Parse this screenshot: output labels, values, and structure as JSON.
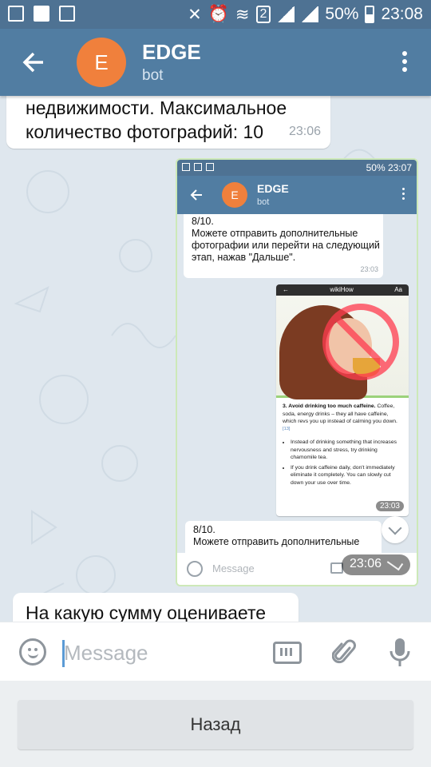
{
  "status_bar": {
    "battery": "50%",
    "time": "23:08",
    "sim_badge": "2"
  },
  "header": {
    "avatar_letter": "E",
    "title": "EDGE",
    "subtitle": "bot"
  },
  "messages": {
    "first": {
      "text": "недвижимости. Максимальное количество фотографий: 10",
      "time": "23:06"
    },
    "last": {
      "text": "На какую сумму оцениваете"
    }
  },
  "forwarded_screenshot": {
    "status": "50% 23:07",
    "avatar_letter": "E",
    "title": "EDGE",
    "subtitle": "bot",
    "message_1": {
      "text": "8/10.\nМожете отправить дополнительные фотографии или перейти на следующий этап, нажав \"Дальше\".",
      "time": "23:03"
    },
    "wikihow": {
      "site": "wikiHow",
      "step_title": "3. Avoid drinking too much caffeine.",
      "step_body": "Coffee, soda, energy drinks – they all have caffeine, which revs you up instead of calming you down.",
      "ref": "[13]",
      "bullet_1": "Instead of drinking something that increases nervousness and stress, try drinking chamomile tea.",
      "bullet_2": "If you drink caffeine daily, don't immediately eliminate it completely. You can slowly cut down your use over time.",
      "time": "23:03"
    },
    "message_2": {
      "text": "8/10.\nМожете отправить дополнительные"
    },
    "input_placeholder": "Message",
    "overlay_time": "23:06"
  },
  "input": {
    "placeholder": "Message"
  },
  "keyboard": {
    "back_label": "Назад"
  }
}
